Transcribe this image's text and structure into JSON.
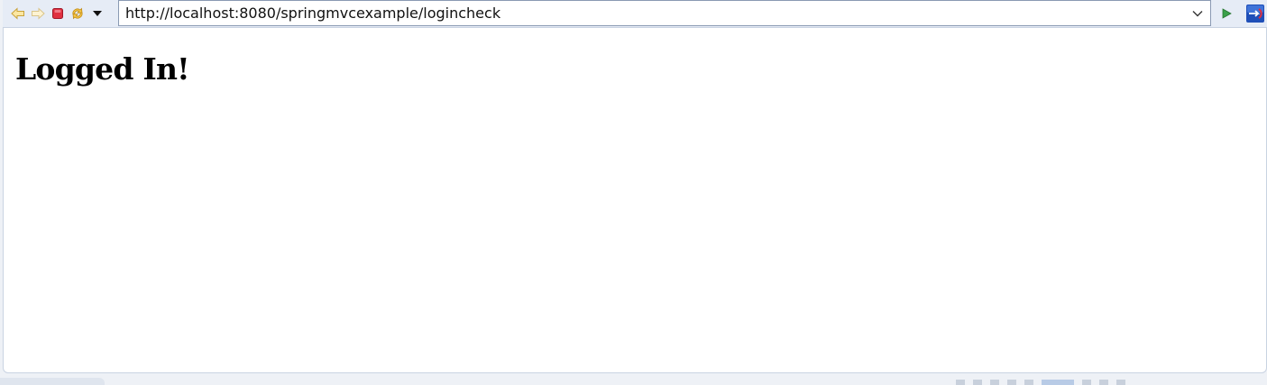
{
  "toolbar": {
    "back_icon": "back-arrow-icon",
    "forward_icon": "forward-arrow-icon",
    "stop_icon": "stop-icon",
    "refresh_icon": "refresh-icon",
    "menu_icon": "dropdown-triangle-icon",
    "go_icon": "go-play-icon",
    "external_icon": "open-external-browser-icon"
  },
  "address_bar": {
    "url": "http://localhost:8080/springmvcexample/logincheck"
  },
  "page": {
    "heading": "Logged In!"
  },
  "colors": {
    "toolbar_bg": "#e6ecf6",
    "content_bg": "#ffffff",
    "stop_red": "#e03040",
    "go_green": "#3aa04a",
    "external_blue": "#1f4fb8"
  }
}
